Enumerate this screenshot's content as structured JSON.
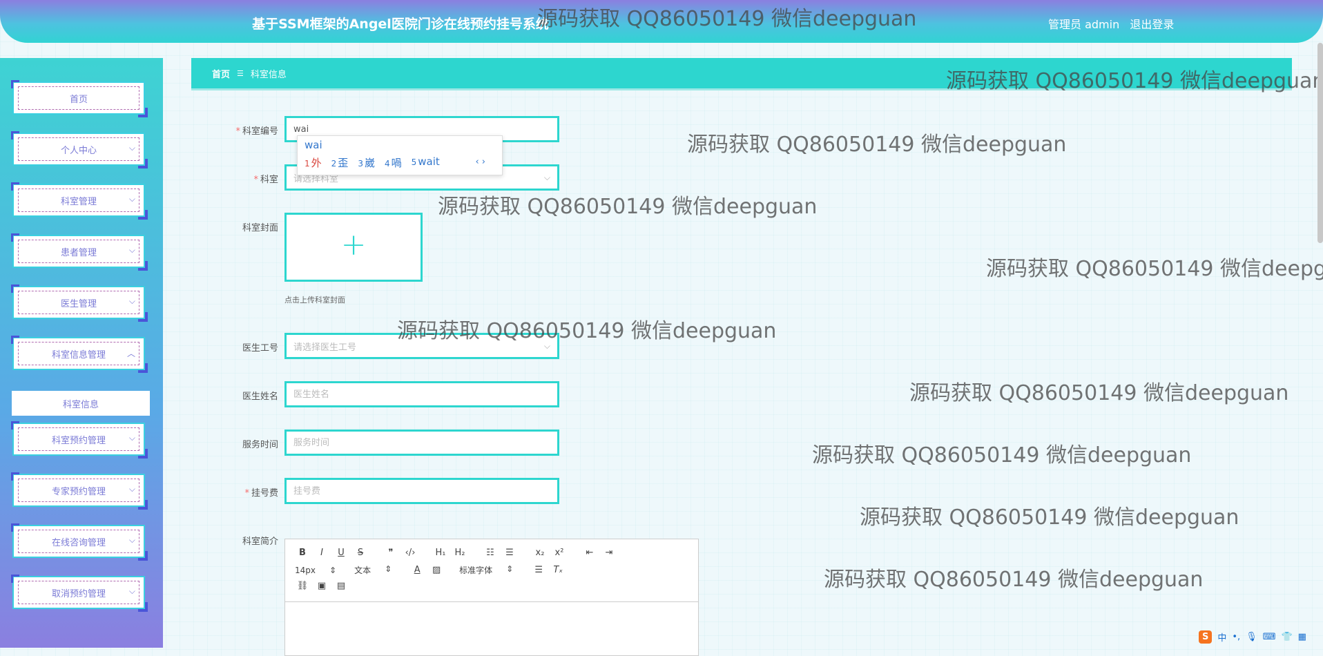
{
  "header": {
    "title": "基于SSM框架的Angel医院门诊在线预约挂号系统",
    "role_label": "管理员 admin",
    "logout_label": "退出登录"
  },
  "sidebar": {
    "items": [
      {
        "label": "首页"
      },
      {
        "label": "个人中心"
      },
      {
        "label": "科室管理"
      },
      {
        "label": "患者管理"
      },
      {
        "label": "医生管理"
      },
      {
        "label": "科室信息管理"
      },
      {
        "label": "科室预约管理"
      },
      {
        "label": "专家预约管理"
      },
      {
        "label": "在线咨询管理"
      },
      {
        "label": "取消预约管理"
      }
    ],
    "submenu_active": "科室信息"
  },
  "breadcrumb": {
    "home": "首页",
    "current": "科室信息"
  },
  "form": {
    "dept_code": {
      "label": "科室编号",
      "value": "wai"
    },
    "dept": {
      "label": "科室",
      "placeholder": "请选择科室"
    },
    "cover": {
      "label": "科室封面",
      "tip": "点击上传科室封面"
    },
    "doctor_id": {
      "label": "医生工号",
      "placeholder": "请选择医生工号"
    },
    "doctor_name": {
      "label": "医生姓名",
      "placeholder": "医生姓名"
    },
    "service_time": {
      "label": "服务时间",
      "placeholder": "服务时间"
    },
    "fee": {
      "label": "挂号费",
      "placeholder": "挂号费"
    },
    "intro": {
      "label": "科室简介"
    }
  },
  "ime": {
    "typed": "wai",
    "candidates": [
      {
        "num": "1",
        "text": "外"
      },
      {
        "num": "2",
        "text": "歪"
      },
      {
        "num": "3",
        "text": "崴"
      },
      {
        "num": "4",
        "text": "喎"
      },
      {
        "num": "5",
        "text": "wait"
      }
    ]
  },
  "editor": {
    "font_size": "14px",
    "text_type": "文本",
    "font_family": "标准字体"
  },
  "watermark": "源码获取 QQ86050149 微信deepguan",
  "tray": {
    "lang": "中"
  },
  "colors": {
    "accent": "#2dd6cf",
    "menu_text": "#7b7bd6",
    "border_dark": "#4a55d8"
  }
}
